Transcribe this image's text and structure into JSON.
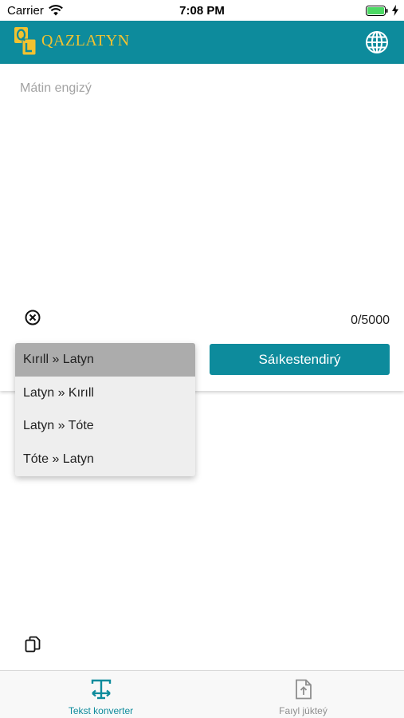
{
  "status_bar": {
    "carrier": "Carrier",
    "time": "7:08 PM",
    "battery_color": "#4cd964"
  },
  "header": {
    "logo_text": "QAZLATYN",
    "logo_icon": "ql-logo-icon",
    "language_icon": "globe-icon",
    "background_color": "#0d8b9c",
    "logo_color": "#f2c230"
  },
  "editor": {
    "value": "",
    "placeholder": "Mátin engizý",
    "clear_icon": "close-circle-icon",
    "char_count": "0/5000",
    "copy_icon": "copy-icon"
  },
  "conversion": {
    "options": [
      {
        "label": "Kırıll » Latyn",
        "selected": true
      },
      {
        "label": "Latyn » Kırıll",
        "selected": false
      },
      {
        "label": "Latyn » Tóte",
        "selected": false
      },
      {
        "label": "Tóte » Latyn",
        "selected": false
      }
    ],
    "convert_label": "Sáıkestendirý"
  },
  "tabs": [
    {
      "label": "Tekst konverter",
      "icon": "text-convert-icon",
      "active": true
    },
    {
      "label": "Faıyl júkteý",
      "icon": "file-upload-icon",
      "active": false
    }
  ]
}
